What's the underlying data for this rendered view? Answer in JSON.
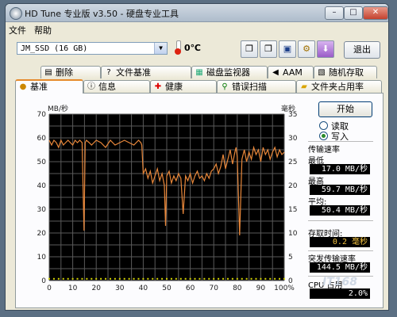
{
  "window": {
    "title": "HD Tune 专业版 v3.50 - 硬盘专业工具"
  },
  "window_buttons": {
    "minimize": "–",
    "maximize": "□",
    "close": "✕"
  },
  "menu": [
    "文件",
    "帮助"
  ],
  "toolbar": {
    "drive": "JM_SSD (16 GB)",
    "temperature": "0℃",
    "exit_label": "退出",
    "icons": [
      "copy-text-icon",
      "copy-screenshot-icon",
      "save-icon",
      "settings-icon",
      "download-icon"
    ]
  },
  "tabs_row1": [
    {
      "label": "删除",
      "icon": "trash-icon"
    },
    {
      "label": "文件基准",
      "icon": "file-benchmark-icon"
    },
    {
      "label": "磁盘监视器",
      "icon": "disk-monitor-icon"
    },
    {
      "label": "AAM",
      "icon": "speaker-icon"
    },
    {
      "label": "随机存取",
      "icon": "random-access-icon"
    }
  ],
  "tabs_row2": [
    {
      "label": "基准",
      "icon": "benchmark-icon"
    },
    {
      "label": "信息",
      "icon": "info-icon"
    },
    {
      "label": "健康",
      "icon": "health-cross-icon"
    },
    {
      "label": "错误扫描",
      "icon": "error-scan-icon"
    },
    {
      "label": "文件夹占用率",
      "icon": "folder-icon"
    }
  ],
  "controls": {
    "start_label": "开始",
    "read_label": "读取",
    "write_label": "写入",
    "selected_mode": "write"
  },
  "stats": {
    "transfer_rate_label": "传输速率",
    "min_label": "最低",
    "min_value": "17.0 MB/秒",
    "max_label": "最高",
    "max_value": "59.7 MB/秒",
    "avg_label": "平均:",
    "avg_value": "50.4 MB/秒",
    "access_time_label": "存取时间:",
    "access_time_value": "0.2 毫秒",
    "burst_label": "突发传输速率",
    "burst_value": "144.5 MB/秒",
    "cpu_label": "CPU 占用",
    "cpu_value": "2.0%"
  },
  "watermark": "IT168",
  "colors": {
    "chart_bg": "#000000",
    "grid": "#5a5a5a",
    "transfer_line": "#e8873a",
    "access_points": "#d4d400"
  },
  "chart_data": {
    "type": "line",
    "title": "",
    "y_left_unit": "MB/秒",
    "y_right_unit": "毫秒",
    "y_left_ticks": [
      0,
      10,
      20,
      30,
      40,
      50,
      60,
      70
    ],
    "y_right_ticks": [
      0,
      5,
      10,
      15,
      20,
      25,
      30,
      35
    ],
    "x_ticks": [
      "0",
      "10",
      "20",
      "30",
      "40",
      "50",
      "60",
      "70",
      "80",
      "90",
      "100%"
    ],
    "ylim_left": [
      0,
      70
    ],
    "ylim_right": [
      0,
      35
    ],
    "xlim": [
      0,
      100
    ],
    "grid": true,
    "series": [
      {
        "axis": "left",
        "x": [
          0,
          1,
          2,
          3,
          4,
          5,
          6,
          7,
          8,
          9,
          10,
          11,
          12,
          13,
          14,
          14.8,
          15.3,
          15.8,
          17,
          18,
          20,
          22,
          24,
          26,
          28,
          30,
          32,
          34,
          36,
          38,
          39,
          39.4,
          40,
          41,
          42,
          43,
          44,
          45,
          46,
          47,
          48,
          49,
          49.5,
          50,
          51,
          52,
          53,
          54,
          55,
          56,
          57,
          58,
          59,
          60,
          61,
          62,
          63,
          64,
          65,
          66,
          67,
          68,
          69,
          70,
          71,
          72,
          73,
          74,
          75,
          76,
          77,
          78,
          79,
          79.5,
          80,
          81,
          82,
          83,
          84,
          85,
          86,
          87,
          88,
          89,
          90,
          91,
          92,
          93,
          94,
          95,
          96,
          97,
          98,
          99,
          100
        ],
        "values": [
          59,
          57,
          59,
          58,
          56,
          59,
          57,
          58,
          59,
          58,
          57,
          59,
          58,
          59,
          58,
          21,
          58,
          59,
          58,
          57,
          59,
          58,
          56,
          59,
          57,
          58,
          59,
          58,
          57,
          59,
          58,
          57,
          45,
          47,
          43,
          46,
          41,
          44,
          47,
          42,
          45,
          40,
          23,
          44,
          46,
          41,
          44,
          42,
          45,
          43,
          28,
          44,
          42,
          45,
          41,
          44,
          46,
          43,
          44,
          42,
          45,
          43,
          46,
          47,
          49,
          45,
          48,
          53,
          47,
          51,
          55,
          49,
          54,
          56,
          52,
          19,
          51,
          55,
          50,
          54,
          51,
          56,
          53,
          55,
          50,
          56,
          53,
          55,
          51,
          54,
          56,
          52,
          55,
          53,
          54
        ]
      },
      {
        "axis": "right",
        "x": [
          0,
          2,
          4,
          6,
          8,
          10,
          12,
          14,
          16,
          18,
          20,
          22,
          24,
          26,
          28,
          30,
          32,
          34,
          36,
          38,
          40,
          42,
          44,
          46,
          48,
          50,
          52,
          54,
          56,
          58,
          60,
          62,
          64,
          66,
          68,
          70,
          72,
          74,
          76,
          78,
          80,
          82,
          84,
          86,
          88,
          90,
          92,
          94,
          96,
          98,
          100
        ],
        "values": [
          0.2,
          0.2,
          0.2,
          0.2,
          0.2,
          0.2,
          0.2,
          0.2,
          0.2,
          0.2,
          0.2,
          0.2,
          0.2,
          0.2,
          0.2,
          0.2,
          0.2,
          0.2,
          0.2,
          0.2,
          0.2,
          0.2,
          0.2,
          0.2,
          0.2,
          0.2,
          0.2,
          0.2,
          0.2,
          0.2,
          0.2,
          0.2,
          0.2,
          0.2,
          0.2,
          0.2,
          0.2,
          0.2,
          0.2,
          0.2,
          0.2,
          0.2,
          0.2,
          0.2,
          0.2,
          0.2,
          0.2,
          0.2,
          0.2,
          0.2,
          0.2
        ]
      }
    ]
  }
}
